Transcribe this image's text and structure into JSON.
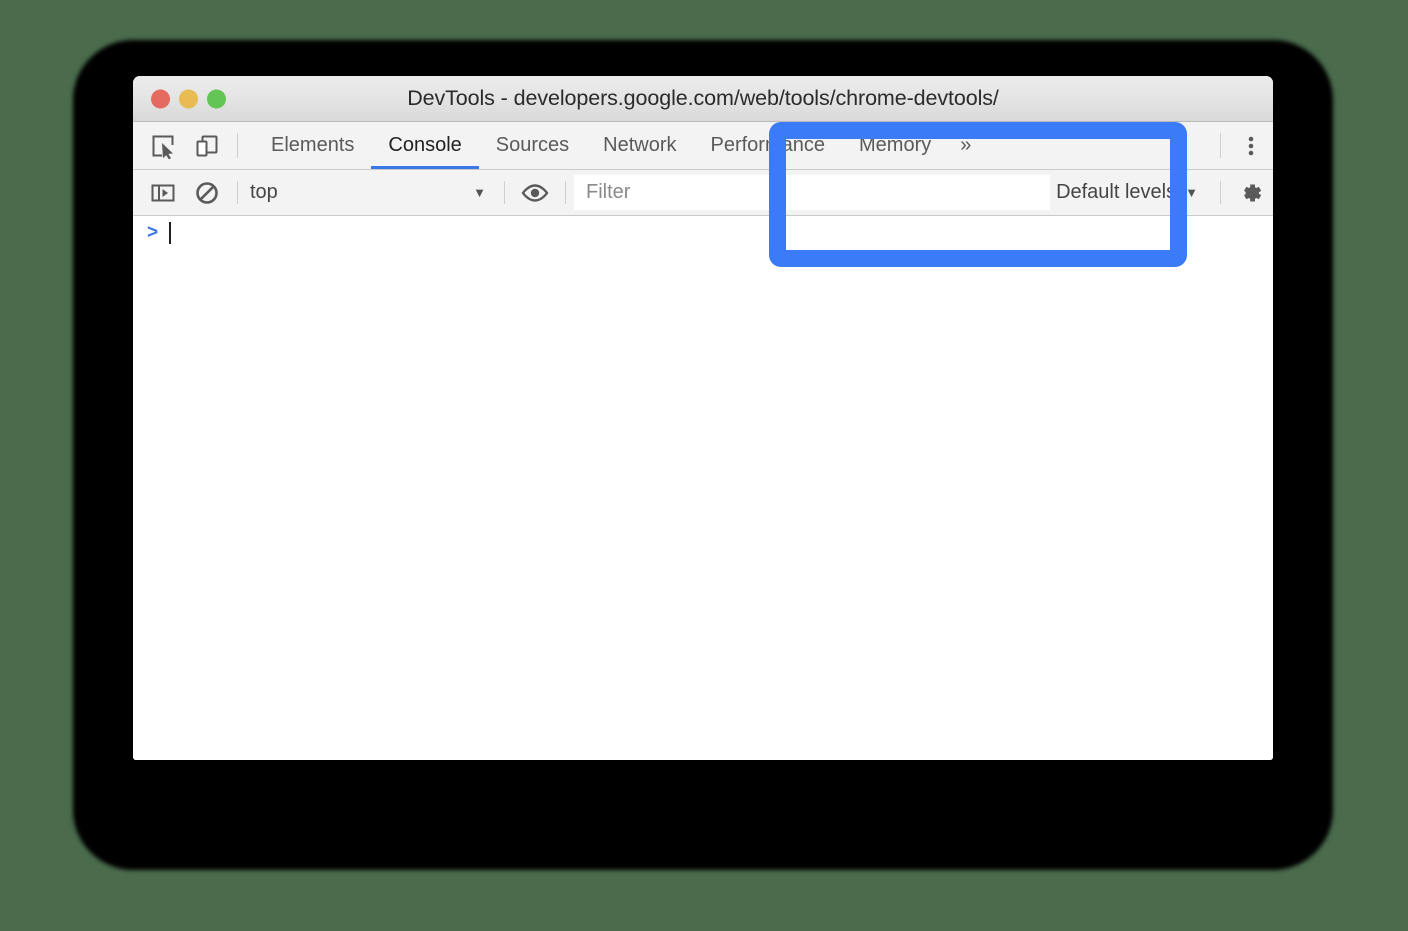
{
  "window": {
    "title": "DevTools - developers.google.com/web/tools/chrome-devtools/",
    "traffic_lights": [
      {
        "name": "close",
        "color": "#e4695e"
      },
      {
        "name": "minimize",
        "color": "#e8bc52"
      },
      {
        "name": "zoom",
        "color": "#63c555"
      }
    ]
  },
  "tab_toolbar": {
    "inspect_icon": "inspect-cursor-icon",
    "device_icon": "device-toolbar-icon",
    "tabs": [
      {
        "label": "Elements",
        "active": false
      },
      {
        "label": "Console",
        "active": true
      },
      {
        "label": "Sources",
        "active": false
      },
      {
        "label": "Network",
        "active": false
      },
      {
        "label": "Performance",
        "active": false
      },
      {
        "label": "Memory",
        "active": false
      }
    ],
    "overflow_label": "»",
    "more_icon": "vertical-dots-icon"
  },
  "filter_toolbar": {
    "sidebar_icon": "console-sidebar-toggle-icon",
    "clear_icon": "clear-console-icon",
    "context": {
      "value": "top",
      "caret": "▼"
    },
    "eye_icon": "live-expression-eye-icon",
    "filter": {
      "value": "",
      "placeholder": "Filter"
    },
    "level": {
      "value": "Default levels",
      "caret": "▼"
    },
    "settings_icon": "gear-icon"
  },
  "console": {
    "prompt_symbol": ">",
    "input_value": ""
  },
  "annotation": {
    "highlight_color": "#3b7bf7"
  },
  "colors": {
    "background": "#4a6b4c",
    "accent_blue": "#3b78e7",
    "toolbar_bg": "#f3f3f3",
    "titlebar_bg": "#e4e4e4"
  }
}
